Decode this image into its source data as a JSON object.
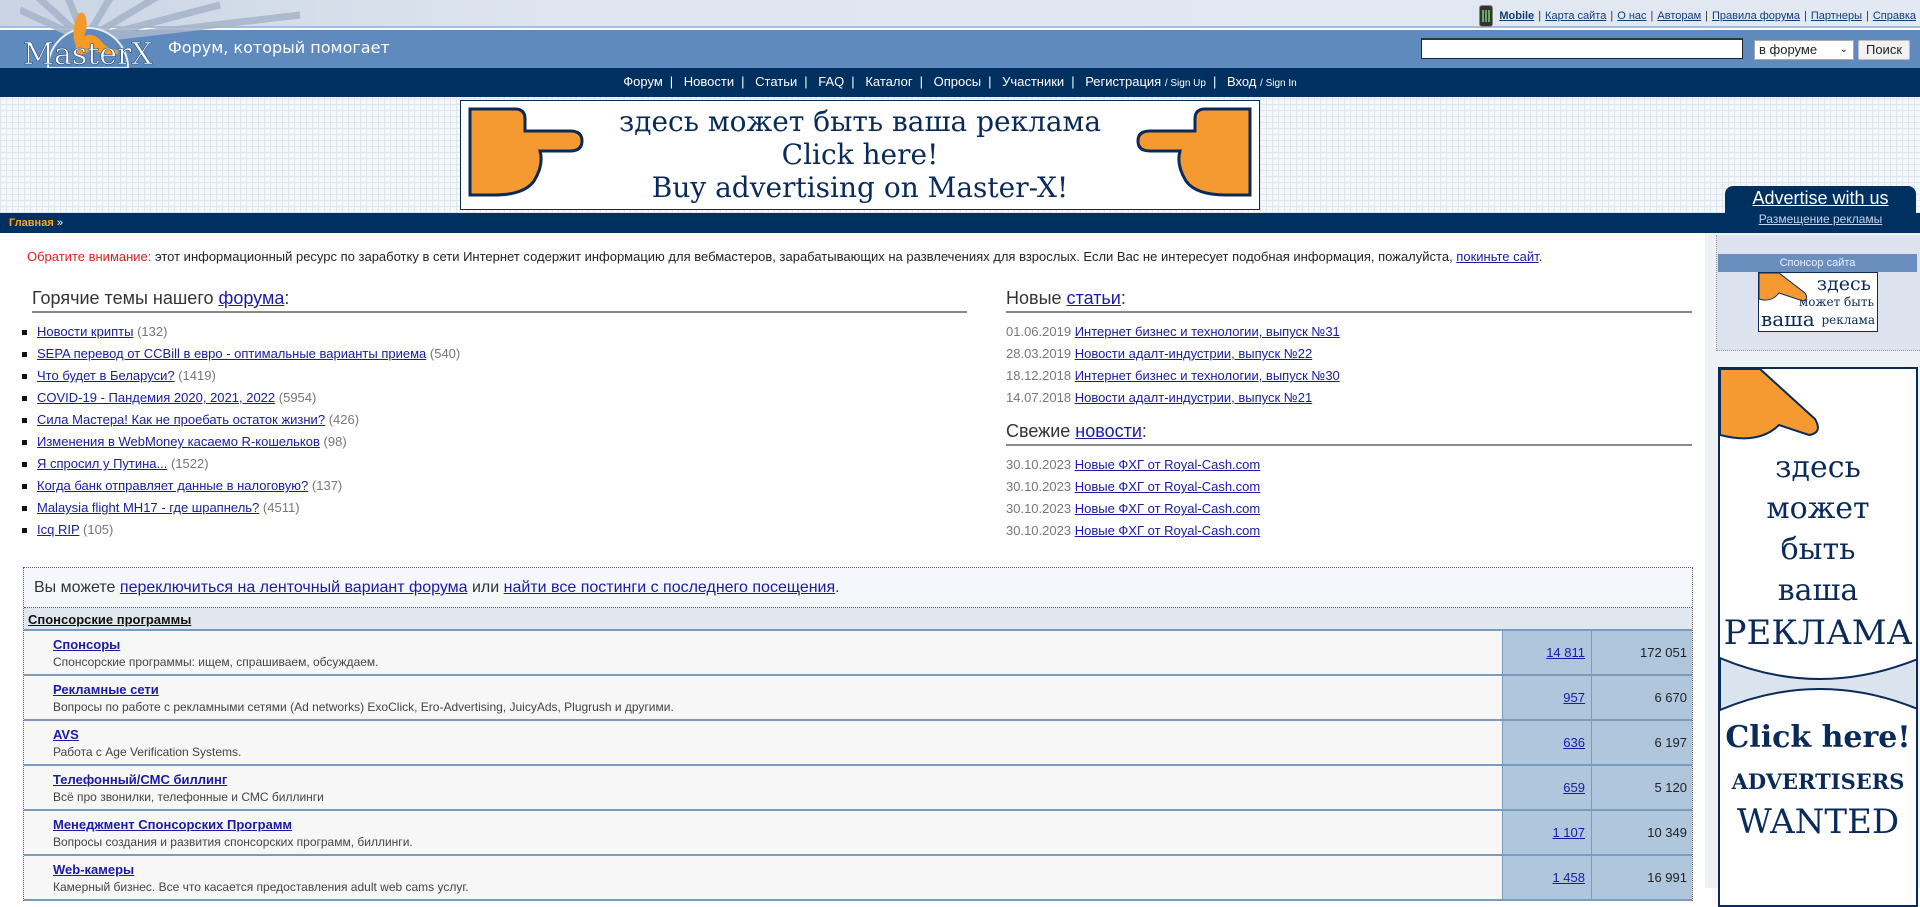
{
  "header": {
    "logo_text": "MasterX",
    "slogan": "Форум, который помогает",
    "top_links": [
      "Mobile",
      "Карта сайта",
      "О нас",
      "Авторам",
      "Правила форума",
      "Партнеры",
      "Справка"
    ],
    "search": {
      "value": "",
      "placeholder": "",
      "scope": "в форуме",
      "button": "Поиск"
    }
  },
  "nav": {
    "items": [
      {
        "label": "Форум"
      },
      {
        "label": "Новости"
      },
      {
        "label": "Статьи"
      },
      {
        "label": "FAQ"
      },
      {
        "label": "Каталог"
      },
      {
        "label": "Опросы"
      },
      {
        "label": "Участники"
      },
      {
        "label": "Регистрация",
        "sub": "/ Sign Up"
      },
      {
        "label": "Вход",
        "sub": "/ Sign In"
      }
    ]
  },
  "banner": {
    "line1": "здесь может быть ваша реклама",
    "line2": "Click here!",
    "line3": "Buy advertising on Master-X!"
  },
  "breadcrumb": {
    "home": "Главная",
    "sep": "»"
  },
  "sidebar": {
    "advertise_title": "Advertise with us",
    "advertise_sub": "Размещение рекламы",
    "sponsor_title": "Спонсор сайта",
    "sponsor_ad": {
      "w1": "здесь",
      "w2": "может быть",
      "w3": "ваша",
      "w4": "реклама"
    },
    "big_ad": {
      "l1": "здесь",
      "l2": "может",
      "l3": "быть",
      "l4": "ваша",
      "l5": "РЕКЛАМА",
      "l6": "Click here!",
      "l7": "ADVERTISERS",
      "l8": "WANTED"
    }
  },
  "notice": {
    "label": "Обратите внимание:",
    "text": " этот информационный ресурс по заработку в сети Интернет содержит информацию для вебмастеров, зарабатывающих на развлечениях для взрослых. Если Вас не интересует подобная информация, пожалуйста, ",
    "link": "покиньте сайт",
    "end": "."
  },
  "hot_topics": {
    "title": "Горячие темы нашего ",
    "title_link": "форума",
    "colon": ":",
    "items": [
      {
        "title": "Новости крипты",
        "count": "(132)"
      },
      {
        "title": "SEPA перевод от CCBill в евро - оптимальные варианты приема",
        "count": "(540)"
      },
      {
        "title": "Что будет в Беларуси?",
        "count": "(1419)"
      },
      {
        "title": "COVID-19 - Пандемия 2020, 2021, 2022",
        "count": "(5954)"
      },
      {
        "title": "Сила Мастера! Как не проебать остаток жизни?",
        "count": "(426)"
      },
      {
        "title": "Изменения в WebMoney касаемо R-кошельков",
        "count": "(98)"
      },
      {
        "title": "Я спросил у Путина...",
        "count": "(1522)"
      },
      {
        "title": "Когда банк отправляет данные в налоговую?",
        "count": "(137)"
      },
      {
        "title": "Malaysia flight MH17 - где шрапнель?",
        "count": "(4511)"
      },
      {
        "title": "Icq RIP",
        "count": "(105)"
      }
    ]
  },
  "articles": {
    "title": "Новые ",
    "title_link": "статьи",
    "colon": ":",
    "items": [
      {
        "date": "01.06.2019",
        "title": "Интернет бизнес и технологии, выпуск №31"
      },
      {
        "date": "28.03.2019",
        "title": "Новости адалт-индустрии, выпуск №22"
      },
      {
        "date": "18.12.2018",
        "title": "Интернет бизнес и технологии, выпуск №30"
      },
      {
        "date": "14.07.2018",
        "title": "Новости адалт-индустрии, выпуск №21"
      }
    ]
  },
  "news": {
    "title": "Свежие ",
    "title_link": "новости",
    "colon": ":",
    "items": [
      {
        "date": "30.10.2023",
        "title": "Новые ФХГ от Royal-Cash.com"
      },
      {
        "date": "30.10.2023",
        "title": "Новые ФХГ от Royal-Cash.com"
      },
      {
        "date": "30.10.2023",
        "title": "Новые ФХГ от Royal-Cash.com"
      },
      {
        "date": "30.10.2023",
        "title": "Новые ФХГ от Royal-Cash.com"
      }
    ]
  },
  "forum": {
    "info_prefix": "Вы можете ",
    "info_link1": "переключиться на ленточный вариант форума",
    "info_mid": " или ",
    "info_link2": "найти все постинги с последнего посещения",
    "info_end": ".",
    "category": "Спонсорские программы",
    "rows": [
      {
        "name": "Спонсоры",
        "desc": "Спонсорские программы: ищем, спрашиваем, обсуждаем.",
        "topics": "14 811",
        "posts": "172 051"
      },
      {
        "name": "Рекламные сети",
        "desc": "Вопросы по работе с рекламными сетями (Ad networks) ExoClick, Ero-Advertising, JuicyAds, Plugrush и другими.",
        "topics": "957",
        "posts": "6 670"
      },
      {
        "name": "AVS",
        "desc": "Работа с Age Verification Systems.",
        "topics": "636",
        "posts": "6 197"
      },
      {
        "name": "Телефонный/СМС биллинг",
        "desc": "Всё про звонилки, телефонные и СМС биллинги",
        "topics": "659",
        "posts": "5 120"
      },
      {
        "name": "Менеджмент Спонсорских Программ",
        "desc": "Вопросы создания и развития спонсорских программ, биллинги.",
        "topics": "1 107",
        "posts": "10 349"
      },
      {
        "name": "Web-камеры",
        "desc": "Камерный бизнес. Все что касается предоставления adult web cams услуг.",
        "topics": "1 458",
        "posts": "16 991"
      }
    ]
  },
  "colors": {
    "nav_bg": "#003060",
    "header_blue": "#5e8abd",
    "cell_blue": "#b0c6dc",
    "accent_orange": "#f5a623",
    "warn_red": "#e02020"
  }
}
